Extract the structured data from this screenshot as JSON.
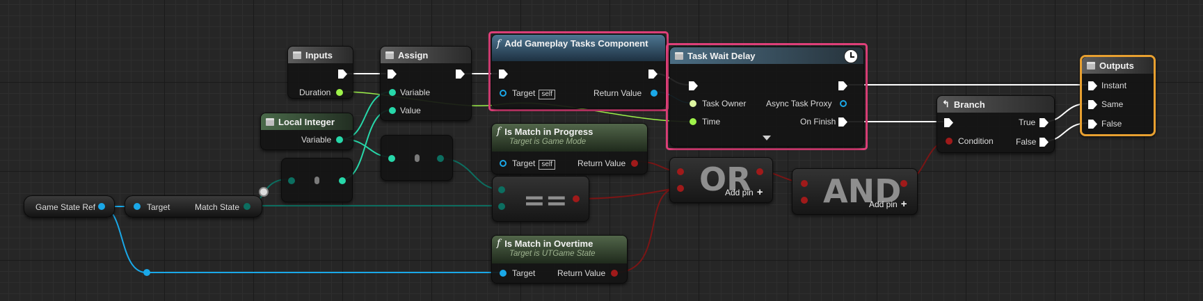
{
  "colors": {
    "exec": "#ffffff",
    "float": "#9ef24a",
    "int": "#27d7a9",
    "object": "#1aa8e8",
    "byte": "#0c6e60",
    "bool": "#a01a1a",
    "highlight": "#e0407a",
    "outputs_border": "#e8a030"
  },
  "nodes": {
    "inputs": {
      "title": "Inputs",
      "duration": "Duration"
    },
    "assign": {
      "title": "Assign",
      "variable": "Variable",
      "value": "Value"
    },
    "local_integer": {
      "title": "Local Integer",
      "variable": "Variable"
    },
    "add_tasks": {
      "title": "Add Gameplay Tasks Component",
      "target": "Target",
      "self": "self",
      "return_value": "Return Value"
    },
    "task_wait_delay": {
      "title": "Task Wait Delay",
      "task_owner": "Task Owner",
      "time": "Time",
      "async_task_proxy": "Async Task Proxy",
      "on_finish": "On Finish"
    },
    "branch": {
      "title": "Branch",
      "condition": "Condition",
      "true_label": "True",
      "false_label": "False"
    },
    "outputs": {
      "title": "Outputs",
      "instant": "Instant",
      "same": "Same",
      "false_label": "False"
    },
    "match_in_progress": {
      "title": "Is Match in Progress",
      "subtitle": "Target is Game Mode",
      "target": "Target",
      "self": "self",
      "return_value": "Return Value"
    },
    "match_in_overtime": {
      "title": "Is Match in Overtime",
      "subtitle": "Target is UTGame State",
      "target": "Target",
      "return_value": "Return Value"
    },
    "game_state_ref": {
      "label": "Game State Ref"
    },
    "match_state": {
      "target": "Target",
      "output": "Match State"
    },
    "equals": {
      "op": "=="
    },
    "or_node": {
      "op": "OR",
      "add_pin": "Add pin"
    },
    "and_node": {
      "op": "AND",
      "add_pin": "Add pin"
    }
  },
  "icons": {
    "variable_node": "struct-icon",
    "function": "function-icon",
    "branch": "branch-icon",
    "latent": "clock-icon",
    "add_pin": "plus-icon"
  }
}
